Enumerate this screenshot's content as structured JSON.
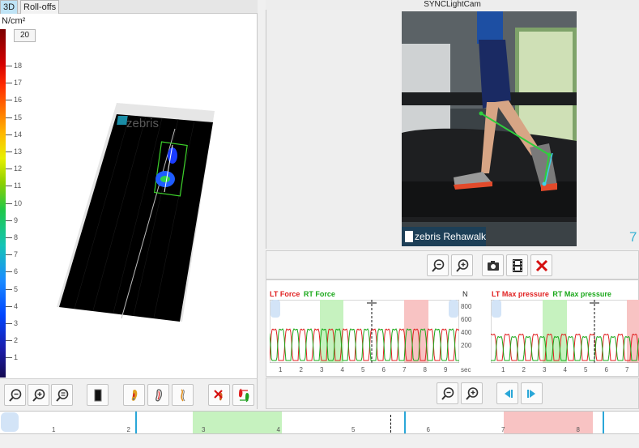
{
  "tabs": [
    {
      "label": "3D",
      "active": true
    },
    {
      "label": "Roll-offs",
      "active": false
    }
  ],
  "pressure_panel": {
    "unit": "N/cm²",
    "scale_max_value": "20",
    "ticks": [
      "18",
      "17",
      "16",
      "15",
      "14",
      "13",
      "12",
      "11",
      "10",
      "9",
      "8",
      "7",
      "6",
      "5",
      "4",
      "3",
      "2",
      "1"
    ],
    "brand_label": "zebris"
  },
  "camera": {
    "title": "SYNCLightCam",
    "overlay_label": "zebris Rehawalk",
    "corner_number": "7"
  },
  "charts": {
    "force": {
      "title_lt": "LT Force",
      "title_rt": "RT Force",
      "unit": "N",
      "y_ticks": [
        "800",
        "600",
        "400",
        "200"
      ],
      "x_ticks": [
        "1",
        "2",
        "3",
        "4",
        "5",
        "6",
        "7",
        "8",
        "9"
      ],
      "x_unit": "sec"
    },
    "pressure": {
      "title_lt": "LT Max pressure",
      "title_rt": "RT Max pressure",
      "x_ticks": [
        "1",
        "2",
        "3",
        "4",
        "5",
        "6",
        "7"
      ]
    }
  },
  "timeline": {
    "ticks": [
      "1",
      "2",
      "3",
      "4",
      "5",
      "6",
      "7",
      "8"
    ]
  },
  "colors": {
    "left_foot": "#e02020",
    "right_foot": "#1aa81a",
    "green_band": "#c6f2bf",
    "red_band": "#f8c3c3",
    "accent_blue": "#2aa7d8"
  }
}
